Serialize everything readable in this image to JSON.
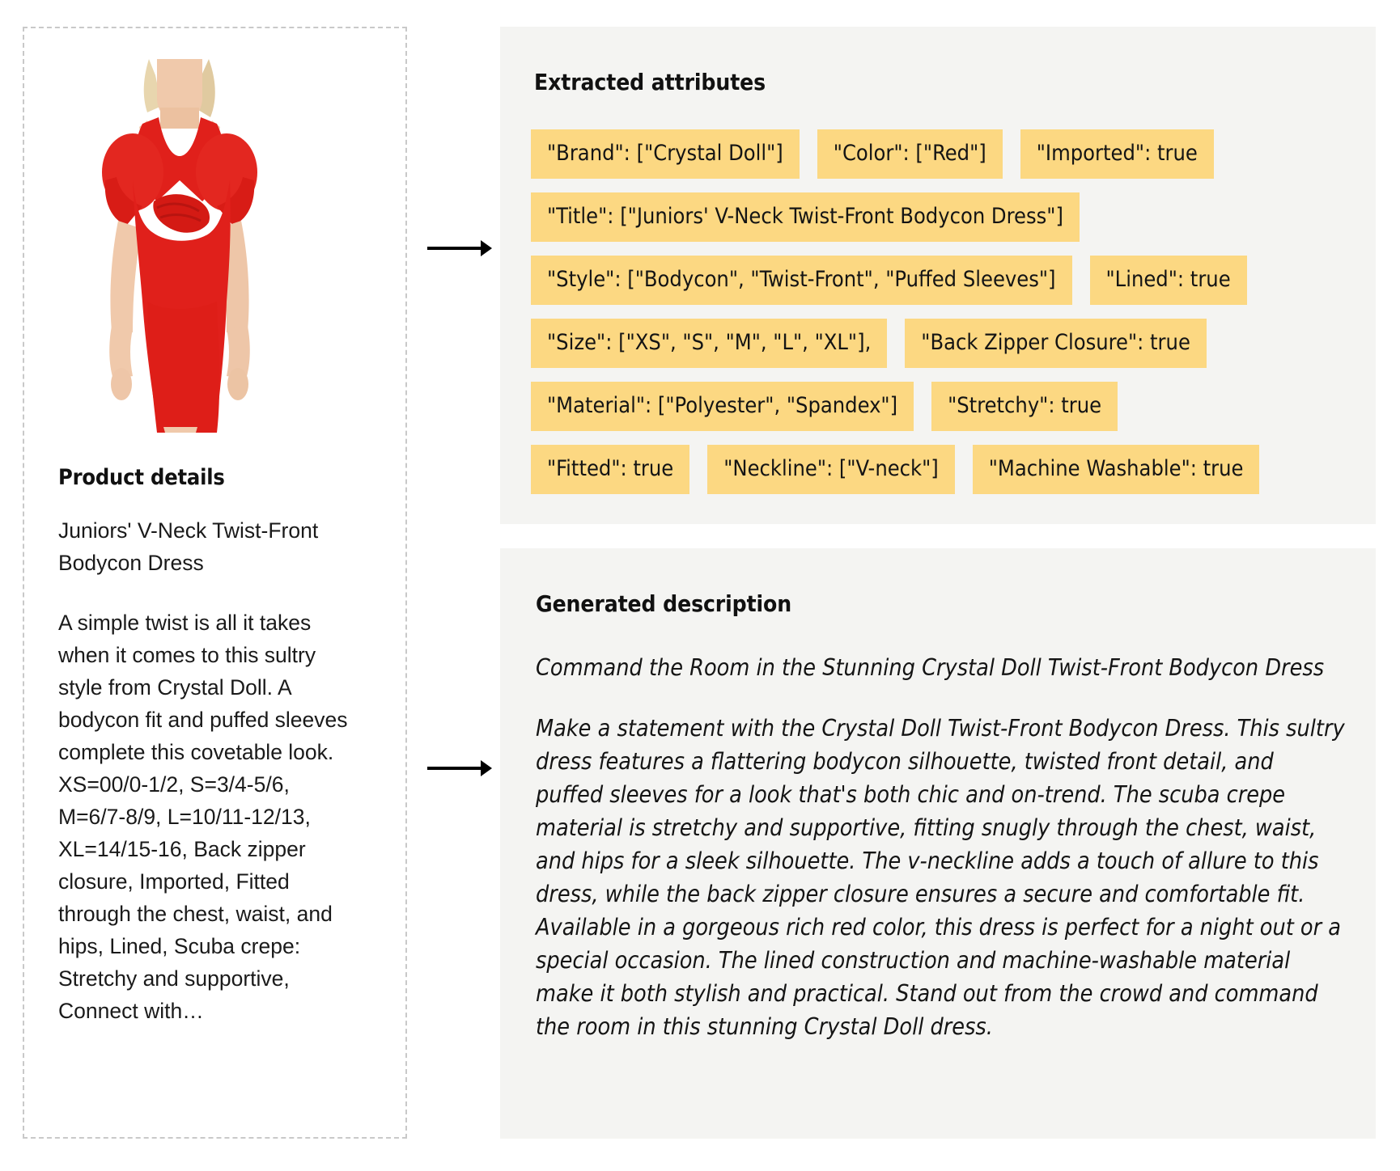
{
  "colors": {
    "tag_background": "#fcd882",
    "panel_background": "#f4f4f2",
    "text": "#141414",
    "dashed_border": "#c9c9c9",
    "dress_red": "#e0201b"
  },
  "left_panel": {
    "product_image_alt": "product-photo-red-bodycon-dress",
    "details_heading": "Product details",
    "product_title": "Juniors' V-Neck Twist-Front Bodycon Dress",
    "product_description": "A simple twist is all it takes when it comes to this sultry style from Crystal Doll. A bodycon fit and puffed sleeves complete this covetable look.\nXS=00/0-1/2, S=3/4-5/6, M=6/7-8/9, L=10/11-12/13, XL=14/15-16, Back zipper closure, Imported, Fitted through the chest, waist, and hips, Lined, Scuba crepe: Stretchy and supportive, Connect with…"
  },
  "attributes_panel": {
    "title": "Extracted attributes",
    "rows": [
      [
        "\"Brand\": [\"Crystal Doll\"]",
        "\"Color\": [\"Red\"]",
        "\"Imported\": true"
      ],
      [
        "\"Title\": [\"Juniors' V-Neck Twist-Front Bodycon Dress\"]"
      ],
      [
        "\"Style\": [\"Bodycon\", \"Twist-Front\", \"Puffed Sleeves\"]",
        "\"Lined\": true"
      ],
      [
        "\"Size\": [\"XS\", \"S\", \"M\", \"L\", \"XL\"],",
        "\"Back Zipper Closure\": true"
      ],
      [
        "\"Material\": [\"Polyester\", \"Spandex\"]",
        "\"Stretchy\": true"
      ],
      [
        "\"Fitted\": true",
        "\"Neckline\": [\"V-neck\"]",
        "\"Machine Washable\": true"
      ]
    ]
  },
  "description_panel": {
    "title": "Generated description",
    "headline": "Command the Room in the Stunning Crystal Doll Twist-Front Bodycon Dress",
    "body": "Make a statement with the Crystal Doll Twist-Front Bodycon Dress. This sultry dress features a flattering bodycon silhouette, twisted front detail, and puffed sleeves for a look that's both chic and on-trend. The scuba crepe material is stretchy and supportive, fitting snugly through the chest, waist, and hips for a sleek silhouette. The v-neckline adds a touch of allure to this dress, while the back zipper closure ensures a secure and comfortable fit. Available in a gorgeous rich red color, this dress is perfect for a night out or a special occasion. The lined construction and machine-washable material make it both stylish and practical. Stand out from the crowd and command the room in this stunning Crystal Doll dress."
  },
  "arrows": {
    "top_arrow_label": "arrow-to-attributes",
    "bottom_arrow_label": "arrow-to-description"
  }
}
